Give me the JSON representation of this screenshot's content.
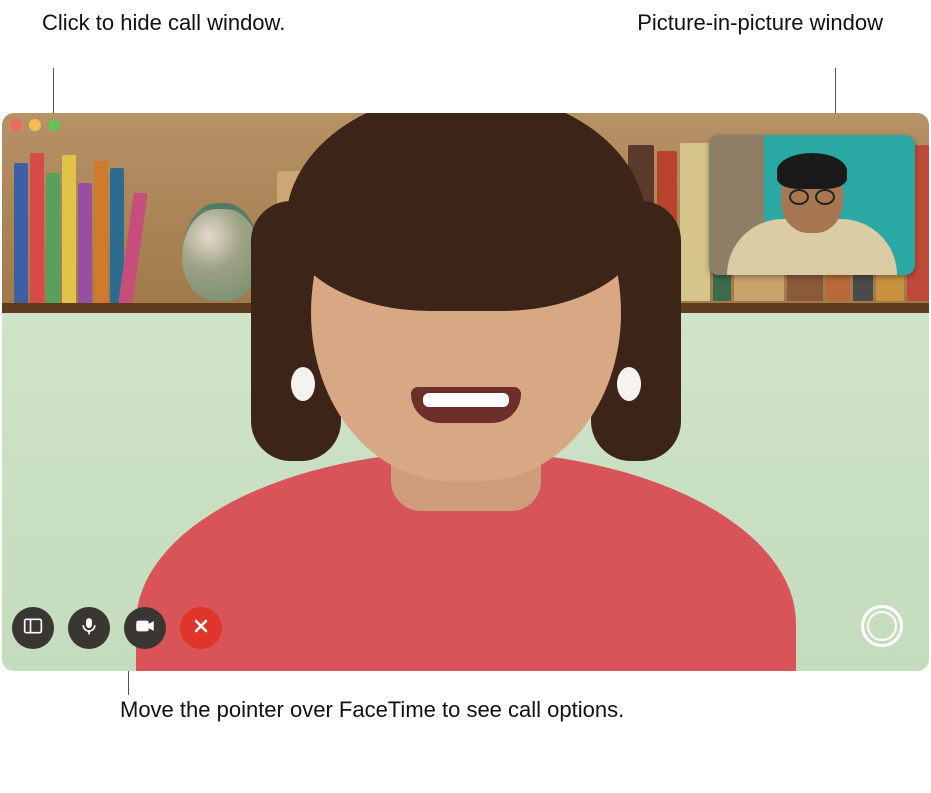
{
  "callouts": {
    "hide_window": "Click to hide call window.",
    "pip": "Picture-in-picture window",
    "options": "Move the pointer over FaceTime to see call options."
  },
  "window": {
    "traffic_lights": [
      "close",
      "minimize",
      "fullscreen"
    ]
  },
  "controls": {
    "sidebar": "Sidebar",
    "mute": "Mute",
    "video": "Video",
    "end": "End Call",
    "live_photo": "Take Live Photo"
  }
}
